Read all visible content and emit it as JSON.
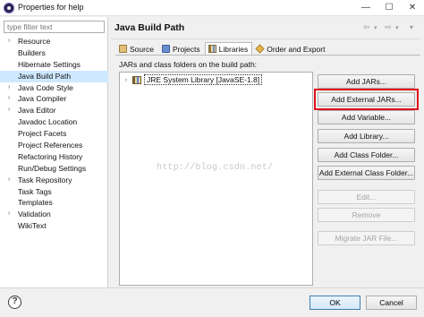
{
  "window": {
    "title": "Properties for help",
    "minimize_glyph": "—",
    "maximize_glyph": "☐",
    "close_glyph": "✕"
  },
  "filter": {
    "placeholder": "type filter text",
    "value": ""
  },
  "tree": {
    "items": [
      {
        "label": "Resource",
        "expandable": true,
        "selected": false
      },
      {
        "label": "Builders",
        "expandable": false,
        "selected": false
      },
      {
        "label": "Hibernate Settings",
        "expandable": false,
        "selected": false
      },
      {
        "label": "Java Build Path",
        "expandable": false,
        "selected": true
      },
      {
        "label": "Java Code Style",
        "expandable": true,
        "selected": false
      },
      {
        "label": "Java Compiler",
        "expandable": true,
        "selected": false
      },
      {
        "label": "Java Editor",
        "expandable": true,
        "selected": false
      },
      {
        "label": "Javadoc Location",
        "expandable": false,
        "selected": false
      },
      {
        "label": "Project Facets",
        "expandable": false,
        "selected": false
      },
      {
        "label": "Project References",
        "expandable": false,
        "selected": false
      },
      {
        "label": "Refactoring History",
        "expandable": false,
        "selected": false
      },
      {
        "label": "Run/Debug Settings",
        "expandable": false,
        "selected": false
      },
      {
        "label": "Task Repository",
        "expandable": true,
        "selected": false
      },
      {
        "label": "Task Tags",
        "expandable": false,
        "selected": false
      },
      {
        "label": "Templates",
        "expandable": false,
        "selected": false
      },
      {
        "label": "Validation",
        "expandable": true,
        "selected": false
      },
      {
        "label": "WikiText",
        "expandable": false,
        "selected": false
      }
    ],
    "expand_glyph": "›"
  },
  "header": {
    "title": "Java Build Path",
    "back_glyph": "⇦",
    "forward_glyph": "⇨",
    "dropdown_glyph": "▾",
    "menu_glyph": "▾"
  },
  "tabs": [
    {
      "label": "Source",
      "icon": "source-folder-icon",
      "active": false
    },
    {
      "label": "Projects",
      "icon": "projects-icon",
      "active": false
    },
    {
      "label": "Libraries",
      "icon": "libraries-icon",
      "active": true
    },
    {
      "label": "Order and Export",
      "icon": "order-export-icon",
      "active": false
    }
  ],
  "libraries": {
    "description": "JARs and class folders on the build path:",
    "items": [
      {
        "label": "JRE System Library [JavaSE-1.8]",
        "expand_glyph": "›"
      }
    ]
  },
  "watermark": "http://blog.csdn.net/",
  "buttons": [
    {
      "label": "Add JARs...",
      "enabled": true
    },
    {
      "label": "Add External JARs...",
      "enabled": true,
      "highlighted": true
    },
    {
      "label": "Add Variable...",
      "enabled": true
    },
    {
      "label": "Add Library...",
      "enabled": true
    },
    {
      "label": "Add Class Folder...",
      "enabled": true
    },
    {
      "label": "Add External Class Folder...",
      "enabled": true
    },
    {
      "label": "Edit...",
      "enabled": false
    },
    {
      "label": "Remove",
      "enabled": false
    },
    {
      "label": "Migrate JAR File...",
      "enabled": false
    }
  ],
  "highlight_color": "#e0101a",
  "footer": {
    "help_glyph": "?",
    "ok_label": "OK",
    "cancel_label": "Cancel"
  }
}
